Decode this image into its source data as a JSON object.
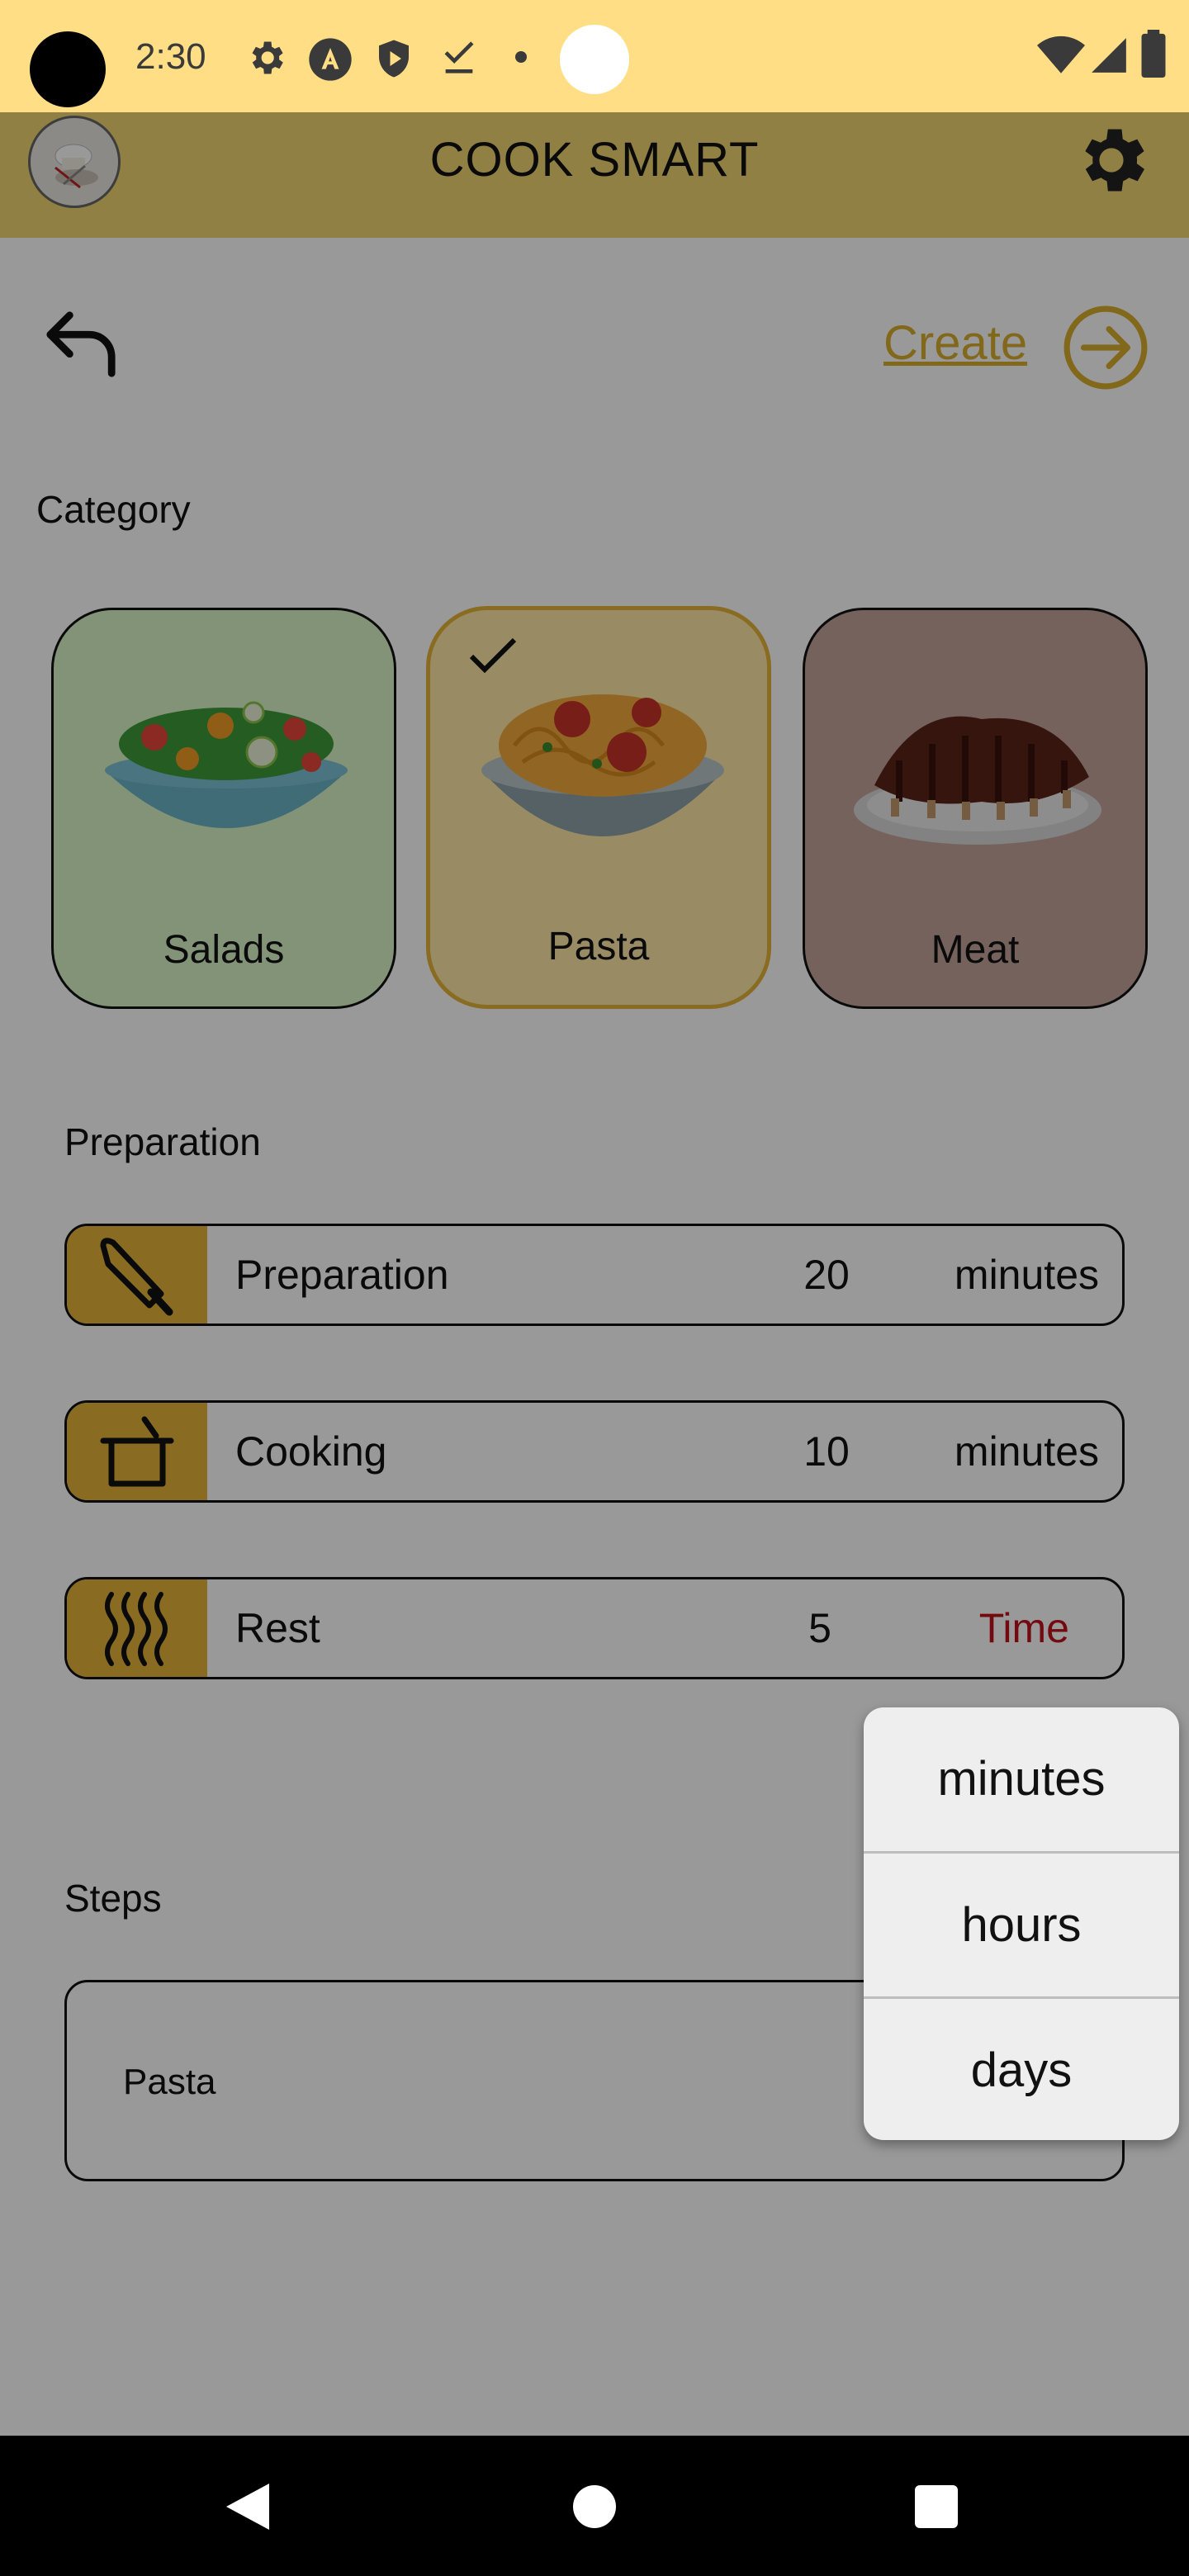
{
  "status_bar": {
    "time": "2:30",
    "icons": [
      "settings-icon",
      "notification-a-icon",
      "shield-play-icon",
      "download-done-icon",
      "dot-icon",
      "wifi-icon",
      "signal-icon",
      "battery-icon"
    ]
  },
  "app_bar": {
    "title": "COOK SMART"
  },
  "nav": {
    "create_label": "Create"
  },
  "category": {
    "label": "Category",
    "cards": [
      {
        "label": "Salads",
        "selected": false,
        "color": "#daf6c8"
      },
      {
        "label": "Pasta",
        "selected": true,
        "color": "#ffe9a8"
      },
      {
        "label": "Meat",
        "selected": false,
        "color": "#c4a39a"
      }
    ]
  },
  "preparation": {
    "label": "Preparation",
    "rows": [
      {
        "label": "Preparation",
        "value": "20",
        "unit": "minutes",
        "icon": "knife-icon"
      },
      {
        "label": "Cooking",
        "value": "10",
        "unit": "minutes",
        "icon": "pot-icon"
      },
      {
        "label": "Rest",
        "value": "5",
        "unit": "Time",
        "icon": "steam-icon"
      }
    ]
  },
  "steps": {
    "label": "Steps",
    "text": "Pasta"
  },
  "unit_menu": {
    "options": [
      "minutes",
      "hours",
      "days"
    ]
  },
  "colors": {
    "status_bar": "#ffde85",
    "app_bar": "#f1d571",
    "accent": "#e5b53a",
    "create_link": "#d9ae2c",
    "time_placeholder": "#c0111a"
  }
}
